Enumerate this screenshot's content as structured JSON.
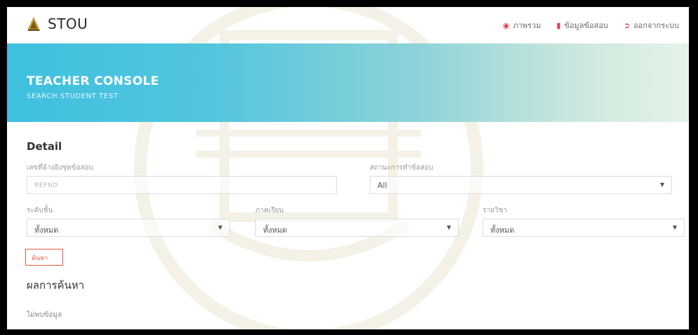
{
  "header": {
    "brand": "STOU",
    "nav": [
      {
        "label": "ภาพรวม",
        "icon": "dashboard-icon"
      },
      {
        "label": "ข้อมูลข้อสอบ",
        "icon": "file-icon"
      },
      {
        "label": "ออกจากระบบ",
        "icon": "logout-icon"
      }
    ]
  },
  "hero": {
    "title": "TEACHER CONSOLE",
    "subtitle": "SEARCH STUDENT TEST"
  },
  "detail": {
    "title": "Detail",
    "refno": {
      "label": "เลขที่อ้างอิงชุดข้อสอบ",
      "placeholder": "REFNO"
    },
    "status": {
      "label": "สถานะการทำข้อสอบ",
      "value": "All"
    },
    "level": {
      "label": "ระดับชั้น",
      "value": "ทั้งหมด"
    },
    "term": {
      "label": "ภาคเรียน",
      "value": "ทั้งหมด"
    },
    "subject": {
      "label": "รายวิชา",
      "value": "ทั้งหมด"
    },
    "search_button": "ค้นหา"
  },
  "result": {
    "title": "ผลการค้นหา",
    "empty": "ไม่พบข้อมูล"
  },
  "colors": {
    "accent": "#e4583e",
    "hero_start": "#3ec0df",
    "nav_icon": "#e23b4e"
  }
}
